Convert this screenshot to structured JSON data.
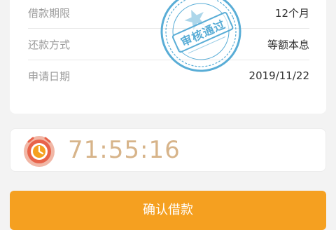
{
  "loan_info": {
    "term_label": "借款期限",
    "term_value": "12个月",
    "repay_label": "还款方式",
    "repay_value": "等额本息",
    "date_label": "申请日期",
    "date_value": "2019/11/22"
  },
  "stamp": {
    "text": "审核通过",
    "color": "#3d9fd0"
  },
  "timer": {
    "icon": "alarm-clock-icon",
    "countdown": "71:55:16",
    "color": "#d7b48a"
  },
  "confirm": {
    "label": "确认借款",
    "color": "#f5a020"
  }
}
